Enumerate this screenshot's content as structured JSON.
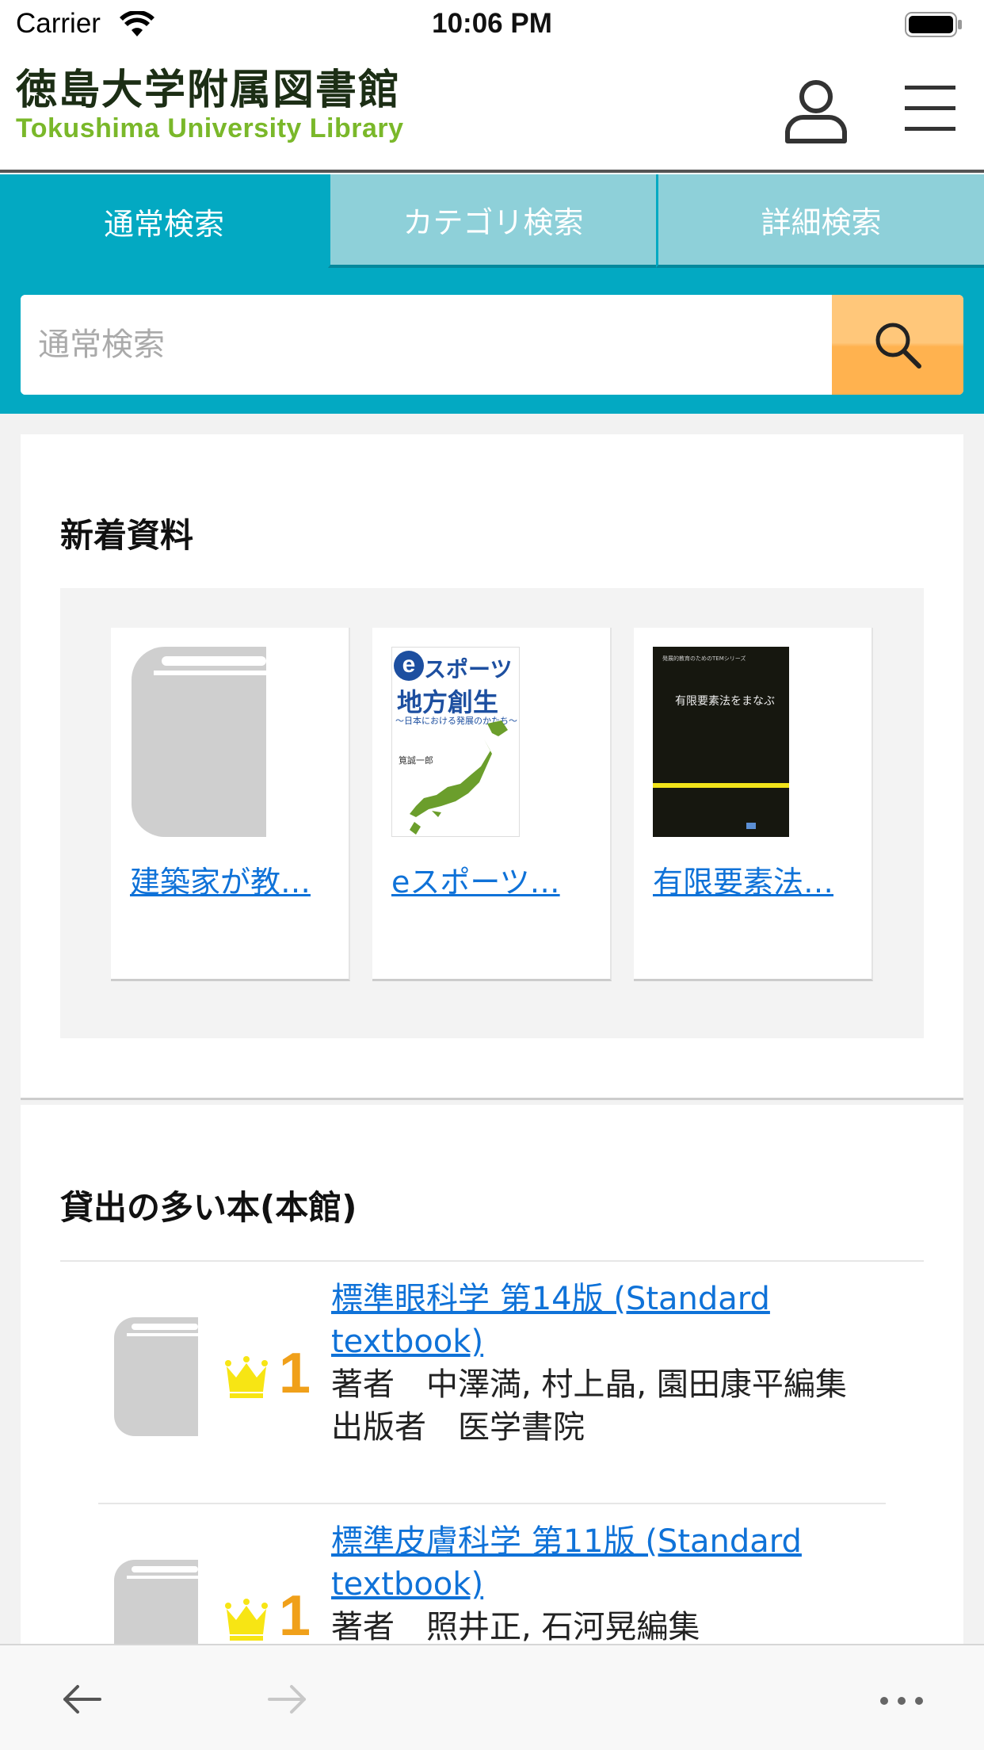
{
  "status_bar": {
    "carrier": "Carrier",
    "time": "10:06 PM"
  },
  "header": {
    "logo_jp": "徳島大学附属図書館",
    "logo_en": "Tokushima University Library",
    "user_icon": "person-icon",
    "menu_icon": "hamburger-menu-icon"
  },
  "search": {
    "tabs": [
      {
        "label": "通常検索",
        "active": true
      },
      {
        "label": "カテゴリ検索",
        "active": false
      },
      {
        "label": "詳細検索",
        "active": false
      }
    ],
    "placeholder": "通常検索",
    "value": "",
    "button_icon": "magnifier-icon"
  },
  "new_materials": {
    "title": "新着資料",
    "books": [
      {
        "title": "建築家が教…",
        "cover": "placeholder-book-icon"
      },
      {
        "title": "eスポーツ…",
        "cover": "esports-cover",
        "cover_text": {
          "line1": "スポーツ",
          "line2": "地方創生",
          "sub": "〜日本における発展のかたち〜",
          "author": "筧誠一郎"
        }
      },
      {
        "title": "有限要素法…",
        "cover": "fem-cover",
        "cover_text": {
          "series": "発展的教育のためのTEMシリーズ",
          "title": "有限要素法をまなぶ"
        }
      }
    ]
  },
  "popular": {
    "title": "貸出の多い本(本館)",
    "items": [
      {
        "rank": "1",
        "title": "標準眼科学 第14版 (Standard textbook)",
        "author_label": "著者",
        "author": "中澤満, 村上晶, 園田康平編集",
        "publisher_label": "出版者",
        "publisher": "医学書院"
      },
      {
        "rank": "1",
        "title": "標準皮膚科学 第11版 (Standard textbook)",
        "author_label": "著者",
        "author": "照井正, 石河晃編集"
      }
    ]
  },
  "toolbar": {
    "back_icon": "arrow-left-icon",
    "forward_icon": "arrow-right-icon",
    "more_icon": "more-dots-icon"
  },
  "colors": {
    "teal": "#03a9c2",
    "tab_inactive": "#8ed0d9",
    "search_orange": "#ffb24f",
    "link_blue": "#0f72d8",
    "rank_orange": "#f0a01a",
    "crown_yellow": "#f7e514"
  }
}
